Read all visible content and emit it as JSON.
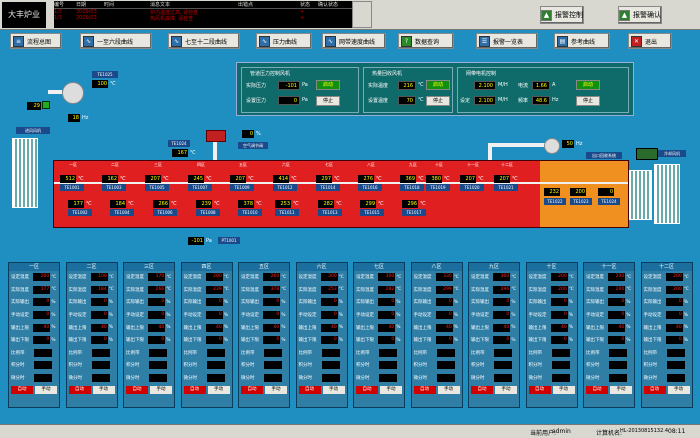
{
  "app": {
    "logo": "大丰炉业"
  },
  "alarm": {
    "headers": [
      "编号",
      "日期",
      "时间",
      "消息文本",
      "出错点",
      "状态",
      "确认状态"
    ],
    "rows": [
      [
        "1/2",
        "2009/03",
        "",
        "炉内温度过高, 请检查",
        "",
        "+",
        ""
      ],
      [
        "1/3",
        "2009/03",
        "",
        "热风机故障, 请检查",
        "",
        "+",
        ""
      ]
    ]
  },
  "top_buttons": [
    {
      "label": "报警控制"
    },
    {
      "label": "报警确认"
    }
  ],
  "nav": [
    {
      "label": "流程总图"
    },
    {
      "label": "一至六段曲线"
    },
    {
      "label": "七至十二段曲线"
    },
    {
      "label": "压力曲线"
    },
    {
      "label": "网带速度曲线"
    },
    {
      "label": "数据查询"
    },
    {
      "label": "报警一览表"
    },
    {
      "label": "参考曲线"
    },
    {
      "label": "退出"
    }
  ],
  "panel": {
    "g1": {
      "title": "管道压力控制风机",
      "l1": "实际压力",
      "v1": "-101",
      "u1": "Pa",
      "l2": "设置压力",
      "v2": "0",
      "u2": "Pa",
      "start": "启动",
      "stop": "停止"
    },
    "g2": {
      "title": "热量回收风机",
      "l1": "实际温度",
      "v1": "216",
      "u1": "℃",
      "l2": "设置温度",
      "v2": "70",
      "u2": "℃",
      "start": "启动",
      "stop": "停止"
    },
    "g3": {
      "title": "网带电机控制",
      "l1": "",
      "v1": "2.100",
      "u1": "M/H",
      "l1b": "电流",
      "v1b": "1.66",
      "u1b": "A",
      "l2": "设定",
      "v2": "2.100",
      "u2": "M/H",
      "l2b": "频率",
      "v2b": "48.6",
      "u2b": "Hz",
      "start": "启动",
      "stop": "停止"
    }
  },
  "equip": {
    "te_top": "TE1025",
    "te_top_val": "100",
    "te_top_unit": "℃",
    "fan_val": "29",
    "fan_unit": "%",
    "hz_val": "18",
    "hz_unit": "Hz",
    "fan_label": "进风风机",
    "te1024": "TE1024",
    "te1024_val": "167",
    "te1024_unit": "℃",
    "valve_val": "0",
    "valve_unit": "%",
    "valve_label": "空气调节阀",
    "right_fan_val": "50",
    "right_fan_unit": "Hz",
    "out_label": "出口回收系统",
    "cool_label": "冷却风机",
    "pt_val": "-101",
    "pt_unit": "Pa",
    "pt_tag": "PT1001"
  },
  "zones": [
    {
      "name": "一区",
      "t1": "512",
      "t1tag": "TE1001",
      "t2": "177",
      "t2tag": "TE1002"
    },
    {
      "name": "二区",
      "t1": "162",
      "t1tag": "TE1003",
      "t2": "184",
      "t2tag": "TE1004"
    },
    {
      "name": "三区",
      "t1": "207",
      "t1tag": "TE1005",
      "t2": "266",
      "t2tag": "TE1006"
    },
    {
      "name": "四区",
      "t1": "245",
      "t1tag": "TE1007",
      "t2": "239",
      "t2tag": "TE1008"
    },
    {
      "name": "五区",
      "t1": "207",
      "t1tag": "TE1009",
      "t2": "378",
      "t2tag": "TE1010"
    },
    {
      "name": "六区",
      "t1": "414",
      "t1tag": "TE1012",
      "t2": "253",
      "t2tag": "TE1011"
    },
    {
      "name": "七区",
      "t1": "297",
      "t1tag": "TE1014",
      "t2": "282",
      "t2tag": "TE1013"
    },
    {
      "name": "八区",
      "t1": "276",
      "t1tag": "TE1016",
      "t2": "299",
      "t2tag": "TE1015"
    },
    {
      "name": "九区",
      "t1": "369",
      "t1tag": "TE1018",
      "t2": "296",
      "t2tag": "TE1017"
    },
    {
      "name": "十区",
      "t1": "380",
      "t1tag": "TE1019",
      "t2": "",
      "t2tag": ""
    },
    {
      "name": "十一区",
      "t1": "207",
      "t1tag": "TE1020",
      "t2": "",
      "t2tag": ""
    },
    {
      "name": "十二区",
      "t1": "207",
      "t1tag": "TE1021",
      "t2": "",
      "t2tag": ""
    }
  ],
  "last_zone": {
    "v1": "232",
    "v2": "200",
    "v3": "0",
    "tags": [
      "TE1022",
      "TE1023",
      "TE1024"
    ]
  },
  "cards": [
    {
      "name": "一区",
      "set": "200",
      "act": "177",
      "out": "0",
      "man": "0",
      "up": "40",
      "low": "0"
    },
    {
      "name": "二区",
      "set": "100",
      "act": "184",
      "out": "0",
      "man": "0",
      "up": "40",
      "low": "0"
    },
    {
      "name": "三区",
      "set": "170",
      "act": "266",
      "out": "0",
      "man": "0",
      "up": "40",
      "low": "0"
    },
    {
      "name": "四区",
      "set": "200",
      "act": "239",
      "out": "0",
      "man": "0",
      "up": "40",
      "low": "0"
    },
    {
      "name": "五区",
      "set": "260",
      "act": "378",
      "out": "0",
      "man": "0",
      "up": "40",
      "low": "0"
    },
    {
      "name": "六区",
      "set": "300",
      "act": "253",
      "out": "0",
      "man": "0",
      "up": "40",
      "low": "0"
    },
    {
      "name": "七区",
      "set": "300",
      "act": "282",
      "out": "0",
      "man": "0",
      "up": "40",
      "low": "0"
    },
    {
      "name": "八区",
      "set": "330",
      "act": "299",
      "out": "0",
      "man": "0",
      "up": "40",
      "low": "0"
    },
    {
      "name": "九区",
      "set": "300",
      "act": "296",
      "out": "0",
      "man": "0",
      "up": "40",
      "low": "0"
    },
    {
      "name": "十区",
      "set": "200",
      "act": "200",
      "out": "0",
      "man": "0",
      "up": "40",
      "low": "0"
    },
    {
      "name": "十一区",
      "set": "200",
      "act": "200",
      "out": "0",
      "man": "0",
      "up": "40",
      "low": "0"
    },
    {
      "name": "十二区",
      "set": "200",
      "act": "200",
      "out": "0",
      "man": "0",
      "up": "40",
      "low": "0"
    }
  ],
  "card_labels": {
    "set": "设定温度",
    "act": "实际温度",
    "out": "实际输出",
    "man": "手动设定",
    "up": "输出上限",
    "low": "输出下限",
    "p": "比例带",
    "i": "积分时",
    "d": "微分时",
    "deg": "℃",
    "pct": "%",
    "auto": "自动",
    "manual": "手动"
  },
  "status": {
    "user_label": "当前用户:",
    "user": "admin",
    "pc_label": "计算机名:",
    "pc": "HL-20130815132.4",
    "time": "08:11"
  }
}
